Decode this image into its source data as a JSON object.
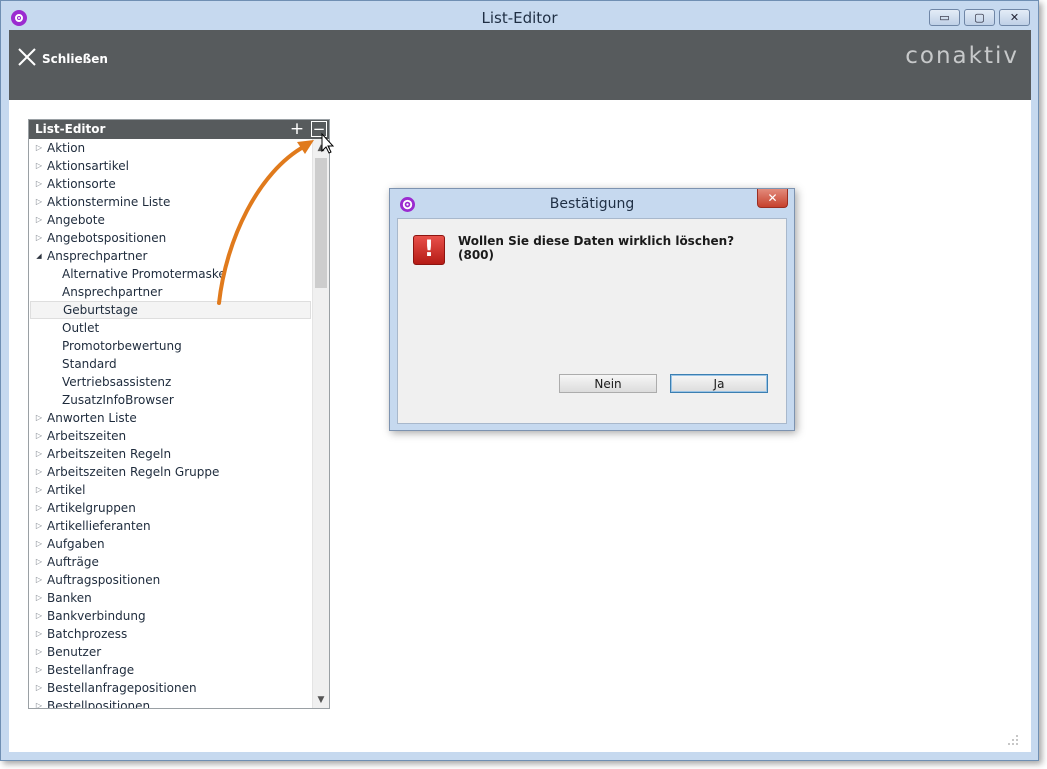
{
  "window": {
    "title": "List-Editor",
    "controls": {
      "minimize": "▭",
      "maximize": "▢",
      "close": "✕"
    }
  },
  "toolbar": {
    "close_label": "Schließen",
    "logo_text": "conaktiv"
  },
  "list_editor": {
    "title": "List-Editor",
    "add_label": "+",
    "remove_label": "−",
    "items": [
      {
        "label": "Aktion",
        "level": 0,
        "expanded": false
      },
      {
        "label": "Aktionsartikel",
        "level": 0,
        "expanded": false
      },
      {
        "label": "Aktionsorte",
        "level": 0,
        "expanded": false
      },
      {
        "label": "Aktionstermine Liste",
        "level": 0,
        "expanded": false
      },
      {
        "label": "Angebote",
        "level": 0,
        "expanded": false
      },
      {
        "label": "Angebotspositionen",
        "level": 0,
        "expanded": false
      },
      {
        "label": "Ansprechpartner",
        "level": 0,
        "expanded": true
      },
      {
        "label": "Alternative Promotermaske",
        "level": 1
      },
      {
        "label": "Ansprechpartner",
        "level": 1
      },
      {
        "label": "Geburtstage",
        "level": 1,
        "selected": true
      },
      {
        "label": "Outlet",
        "level": 1
      },
      {
        "label": "Promotorbewertung",
        "level": 1
      },
      {
        "label": "Standard",
        "level": 1
      },
      {
        "label": "Vertriebsassistenz",
        "level": 1
      },
      {
        "label": "ZusatzInfoBrowser",
        "level": 1
      },
      {
        "label": "Anworten Liste",
        "level": 0,
        "expanded": false
      },
      {
        "label": "Arbeitszeiten",
        "level": 0,
        "expanded": false
      },
      {
        "label": "Arbeitszeiten Regeln",
        "level": 0,
        "expanded": false
      },
      {
        "label": "Arbeitszeiten Regeln Gruppe",
        "level": 0,
        "expanded": false
      },
      {
        "label": "Artikel",
        "level": 0,
        "expanded": false
      },
      {
        "label": "Artikelgruppen",
        "level": 0,
        "expanded": false
      },
      {
        "label": "Artikellieferanten",
        "level": 0,
        "expanded": false
      },
      {
        "label": "Aufgaben",
        "level": 0,
        "expanded": false
      },
      {
        "label": "Aufträge",
        "level": 0,
        "expanded": false
      },
      {
        "label": "Auftragspositionen",
        "level": 0,
        "expanded": false
      },
      {
        "label": "Banken",
        "level": 0,
        "expanded": false
      },
      {
        "label": "Bankverbindung",
        "level": 0,
        "expanded": false
      },
      {
        "label": "Batchprozess",
        "level": 0,
        "expanded": false
      },
      {
        "label": "Benutzer",
        "level": 0,
        "expanded": false
      },
      {
        "label": "Bestellanfrage",
        "level": 0,
        "expanded": false
      },
      {
        "label": "Bestellanfragepositionen",
        "level": 0,
        "expanded": false
      },
      {
        "label": "Bestellpositionen",
        "level": 0,
        "expanded": false
      }
    ]
  },
  "dialog": {
    "title": "Bestätigung",
    "close_label": "✕",
    "message_line1": "Wollen Sie diese Daten wirklich löschen?",
    "message_line2": "(800)",
    "no_label": "Nein",
    "yes_label": "Ja"
  },
  "colors": {
    "toolbar_bg": "#575b5d",
    "frame": "#c6d9ef",
    "accent_arrow": "#e07a1c",
    "error_red": "#c9271f"
  }
}
